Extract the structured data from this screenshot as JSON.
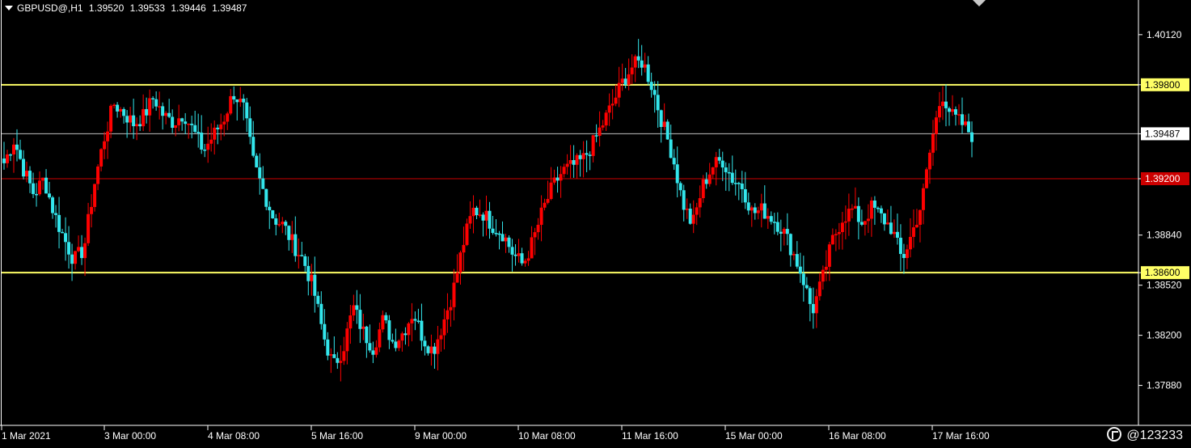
{
  "header": {
    "symbol": "GBPUSD@,H1",
    "open": "1.39520",
    "high": "1.39533",
    "low": "1.39446",
    "close": "1.39487"
  },
  "watermark": "@123233",
  "colors": {
    "background": "#000000",
    "bull": "#ff0000",
    "bear": "#33e6ec",
    "axis": "#ffffff",
    "level_yellow": "#ffff66",
    "level_red": "#cc0000",
    "current_line": "#c0c0c0"
  },
  "chart_data": {
    "type": "candlestick",
    "title": "GBPUSD@,H1",
    "xlabel": "",
    "ylabel": "",
    "ylim": [
      1.3763,
      1.403
    ],
    "y_ticks": [
      "1.40120",
      "1.39800",
      "1.39487",
      "1.39200",
      "1.38840",
      "1.38600",
      "1.38520",
      "1.38200",
      "1.37880"
    ],
    "x_ticks": [
      "1 Mar 2021",
      "3 Mar 00:00",
      "4 Mar 08:00",
      "5 Mar 16:00",
      "9 Mar 00:00",
      "10 Mar 08:00",
      "11 Mar 16:00",
      "15 Mar 00:00",
      "16 Mar 08:00",
      "17 Mar 16:00"
    ],
    "levels": [
      {
        "price": 1.398,
        "label": "1.39800",
        "style": "yellow"
      },
      {
        "price": 1.39487,
        "label": "1.39487",
        "style": "current"
      },
      {
        "price": 1.392,
        "label": "1.39200",
        "style": "red"
      },
      {
        "price": 1.386,
        "label": "1.38600",
        "style": "yellow"
      }
    ],
    "close_path": [
      1.393,
      1.3945,
      1.3925,
      1.391,
      1.392,
      1.3898,
      1.3882,
      1.3868,
      1.3875,
      1.3915,
      1.3945,
      1.3968,
      1.3962,
      1.3955,
      1.396,
      1.3972,
      1.396,
      1.3956,
      1.3962,
      1.395,
      1.3938,
      1.3948,
      1.3958,
      1.3975,
      1.3965,
      1.393,
      1.3912,
      1.3895,
      1.389,
      1.3878,
      1.3868,
      1.385,
      1.382,
      1.38,
      1.3812,
      1.3838,
      1.3822,
      1.3812,
      1.383,
      1.3815,
      1.3822,
      1.3835,
      1.3818,
      1.381,
      1.3828,
      1.3848,
      1.3878,
      1.39,
      1.3898,
      1.389,
      1.3885,
      1.3872,
      1.3865,
      1.388,
      1.39,
      1.3915,
      1.3925,
      1.3928,
      1.3932,
      1.3942,
      1.3955,
      1.3968,
      1.3982,
      1.3992,
      1.3995,
      1.3978,
      1.3955,
      1.3935,
      1.3905,
      1.389,
      1.3915,
      1.3928,
      1.3932,
      1.392,
      1.3915,
      1.3898,
      1.39,
      1.3895,
      1.3888,
      1.3874,
      1.3858,
      1.3835,
      1.3855,
      1.388,
      1.3895,
      1.39,
      1.3892,
      1.3902,
      1.3895,
      1.3888,
      1.3868,
      1.3885,
      1.3905,
      1.3945,
      1.3975,
      1.396,
      1.3955,
      1.3948
    ],
    "series": [
      {
        "name": "bull",
        "color": "#ff0000"
      },
      {
        "name": "bear",
        "color": "#33e6ec"
      }
    ]
  }
}
